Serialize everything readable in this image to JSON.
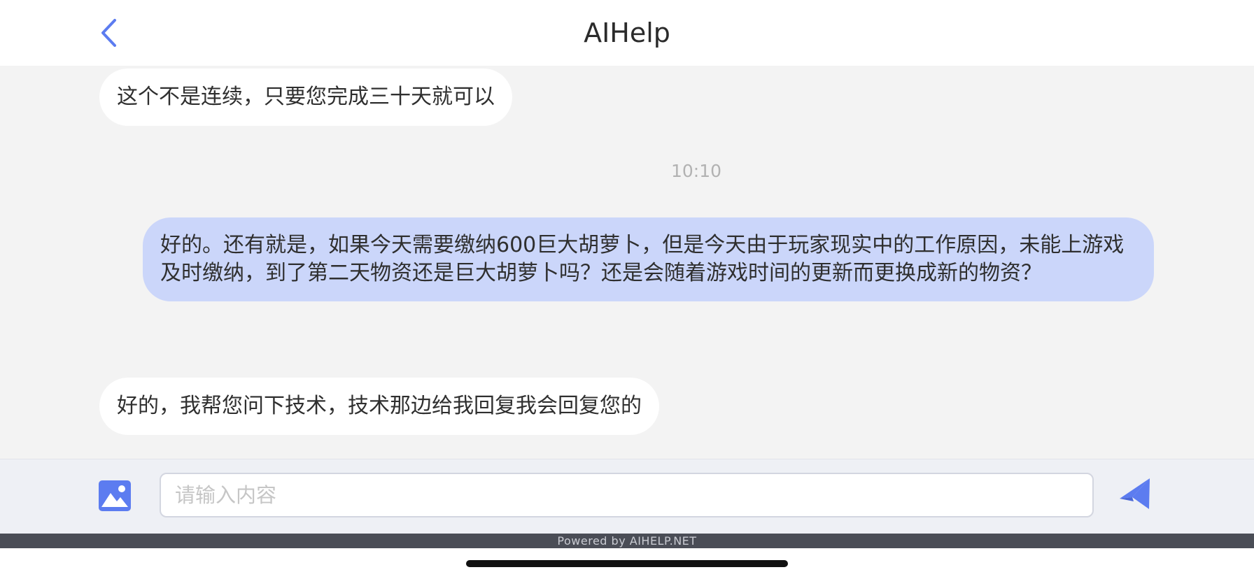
{
  "header": {
    "title": "AIHelp",
    "back_icon": "chevron-left-icon"
  },
  "messages": [
    {
      "sender": "agent",
      "text": "这个不是连续，只要您完成三十天就可以"
    },
    {
      "type": "timestamp",
      "text": "10:10"
    },
    {
      "sender": "user",
      "text": "好的。还有就是，如果今天需要缴纳600巨大胡萝卜，但是今天由于玩家现实中的工作原因，未能上游戏及时缴纳，到了第二天物资还是巨大胡萝卜吗？还是会随着游戏时间的更新而更换成新的物资？"
    },
    {
      "sender": "agent",
      "text": "好的，我帮您问下技术，技术那边给我回复我会回复您的"
    }
  ],
  "input_bar": {
    "placeholder": "请输入内容",
    "value": "",
    "image_icon": "image-icon",
    "send_icon": "send-icon"
  },
  "footer": {
    "powered_by": "Powered by AIHELP.NET"
  },
  "colors": {
    "accent": "#5c7cf0",
    "user_bubble": "#cbd6fa",
    "agent_bubble": "#ffffff",
    "background": "#f3f3f3"
  }
}
